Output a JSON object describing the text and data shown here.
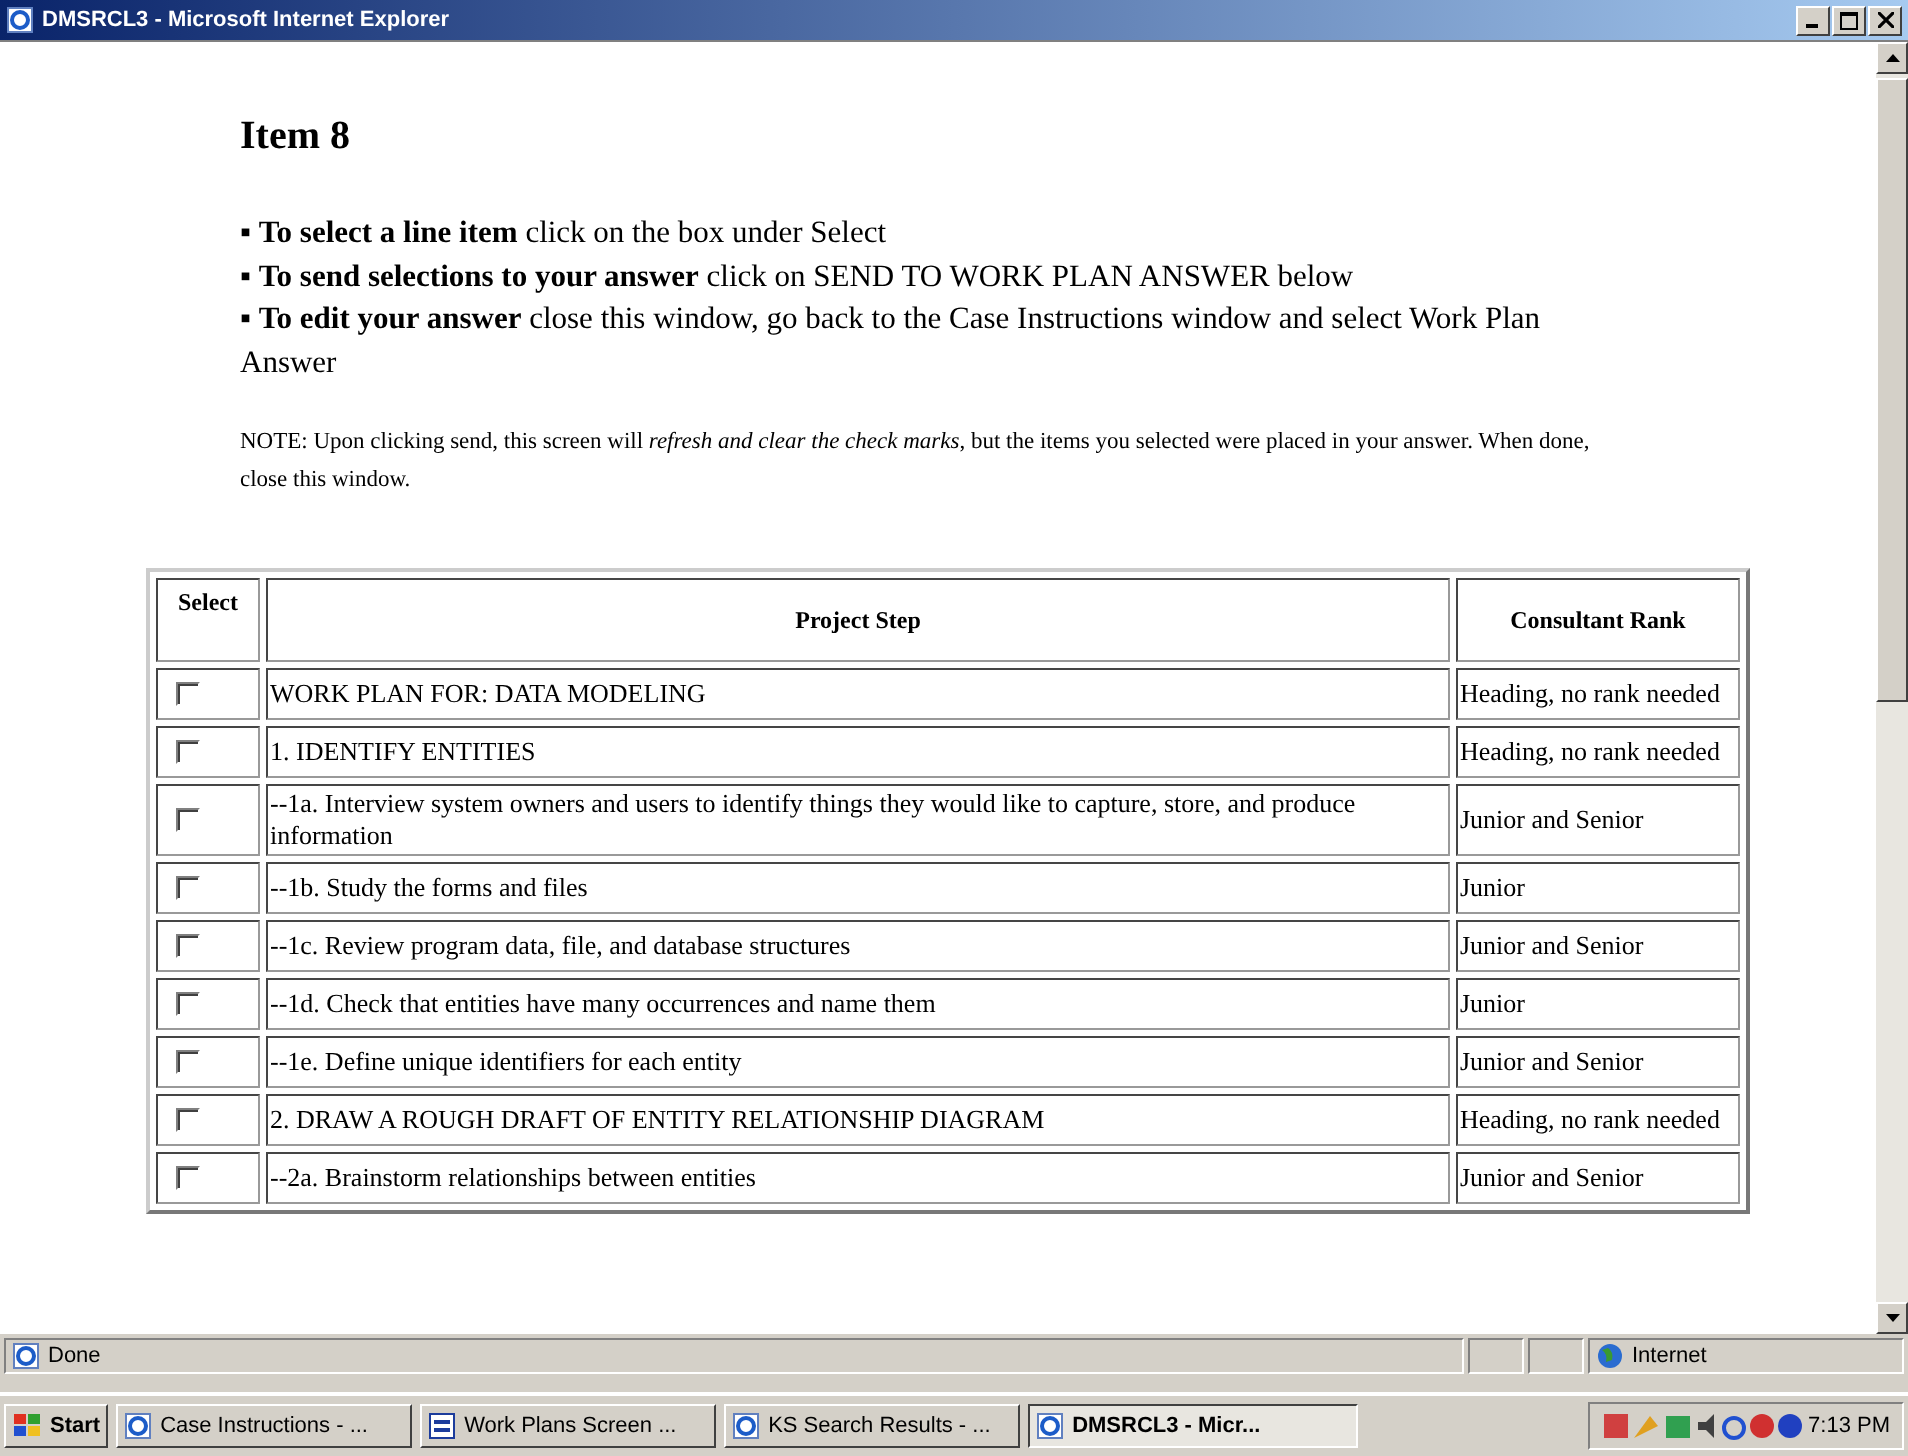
{
  "window": {
    "title": "DMSRCL3 - Microsoft Internet Explorer"
  },
  "page": {
    "heading": "Item 8",
    "bullet": "▪",
    "instructions": [
      "**To select a line item** click on the box under Select",
      "**To send selections to your answer** click on SEND TO WORK PLAN ANSWER below",
      "**To edit your answer** close this window, go back to the Case Instructions window and select Work Plan Answer"
    ],
    "note": "NOTE: Upon clicking send, this screen will *refresh and clear the check marks*, but the items you selected were placed in your answer.   When done, close this window."
  },
  "table": {
    "columns": [
      "Select",
      "Project Step",
      "Consultant Rank"
    ],
    "rows": [
      {
        "checked": false,
        "step": "WORK PLAN FOR: DATA MODELING",
        "rank": "Heading, no rank needed"
      },
      {
        "checked": false,
        "step": "1. IDENTIFY ENTITIES",
        "rank": "Heading, no rank needed"
      },
      {
        "checked": false,
        "step": "--1a. Interview system owners and users to identify things they would like to capture, store, and produce information",
        "rank": "Junior and Senior"
      },
      {
        "checked": false,
        "step": "--1b. Study the forms and files",
        "rank": "Junior"
      },
      {
        "checked": false,
        "step": "--1c. Review program data, file, and database structures",
        "rank": "Junior and Senior"
      },
      {
        "checked": false,
        "step": "--1d. Check that entities have many occurrences and name them",
        "rank": "Junior"
      },
      {
        "checked": false,
        "step": "--1e. Define unique identifiers for each entity",
        "rank": "Junior and Senior"
      },
      {
        "checked": false,
        "step": "2. DRAW A ROUGH DRAFT OF ENTITY RELATIONSHIP DIAGRAM",
        "rank": "Heading, no rank needed"
      },
      {
        "checked": false,
        "step": "--2a. Brainstorm relationships between entities",
        "rank": "Junior and Senior"
      }
    ]
  },
  "status_bar": {
    "status": "Done",
    "zone": "Internet"
  },
  "taskbar": {
    "start": "Start",
    "items": [
      {
        "label": "Case Instructions - ...",
        "kind": "ie",
        "selected": false
      },
      {
        "label": "Work Plans Screen ...",
        "kind": "word",
        "selected": false
      },
      {
        "label": "KS Search Results - ...",
        "kind": "ie",
        "selected": false
      },
      {
        "label": "DMSRCL3 - Micr...",
        "kind": "ie",
        "selected": true
      }
    ],
    "clock": "7:13 PM"
  }
}
